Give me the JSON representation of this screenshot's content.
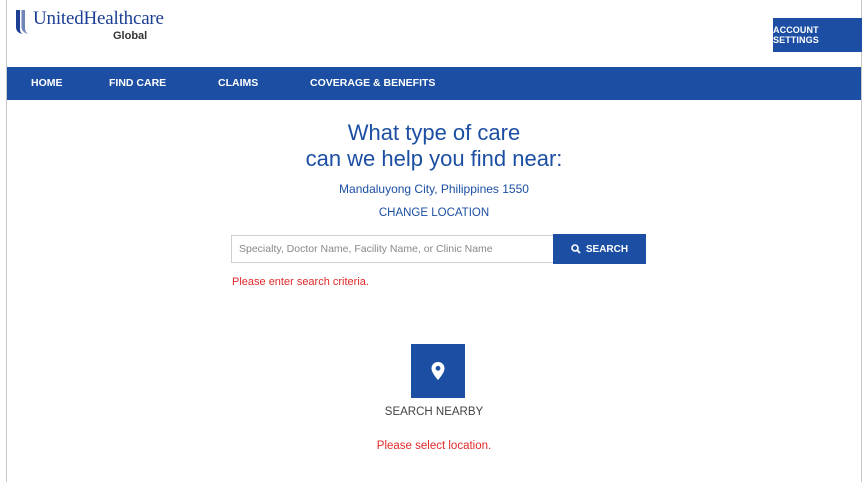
{
  "header": {
    "brand_name": "UnitedHealthcare",
    "brand_sub": "Global",
    "account_settings_label": "ACCOUNT SETTINGS"
  },
  "nav": {
    "items": [
      "HOME",
      "FIND CARE",
      "CLAIMS",
      "COVERAGE & BENEFITS"
    ]
  },
  "main": {
    "headline_line1": "What type of care",
    "headline_line2": "can we help you find near:",
    "location": "Mandaluyong City, Philippines 1550",
    "change_location_label": "CHANGE LOCATION",
    "search": {
      "value": "",
      "placeholder": "Specialty, Doctor Name, Facility Name, or Clinic Name",
      "button_label": "SEARCH",
      "error": "Please enter search criteria."
    },
    "nearby": {
      "label": "SEARCH NEARBY",
      "error": "Please select location.",
      "icon": "location-pin-icon"
    }
  },
  "colors": {
    "brand_blue": "#1c4fa3",
    "error_red": "#e02a2a"
  }
}
